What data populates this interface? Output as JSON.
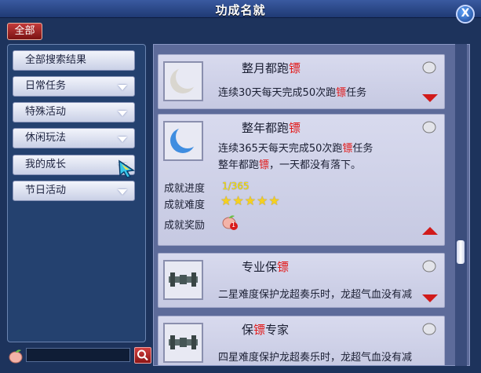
{
  "window": {
    "title": "功成名就",
    "close_label": "X"
  },
  "all_button": "全部",
  "categories": [
    {
      "label": "全部搜索结果",
      "has_chevron": false
    },
    {
      "label": "日常任务",
      "has_chevron": true
    },
    {
      "label": "特殊活动",
      "has_chevron": true
    },
    {
      "label": "休闲玩法",
      "has_chevron": true
    },
    {
      "label": "我的成长",
      "has_chevron": true
    },
    {
      "label": "节日活动",
      "has_chevron": true
    }
  ],
  "search": {
    "value": "",
    "placeholder": ""
  },
  "achievements": [
    {
      "title_pre": "整月都跑",
      "title_red": "镖",
      "title_post": "",
      "desc_pre": "连续30天每天完成50次跑",
      "desc_red": "镖",
      "desc_post": "任务",
      "icon": "crescent-moon-icon",
      "expanded": false
    },
    {
      "title_pre": "整年都跑",
      "title_red": "镖",
      "title_post": "",
      "desc_pre": "连续365天每天完成50次跑",
      "desc_red": "镖",
      "desc_post": "任务",
      "desc2_pre": "整年都跑",
      "desc2_red": "镖",
      "desc2_post": "，一天都没有落下。",
      "icon": "blue-crescent-moon-icon",
      "expanded": true,
      "progress_label": "成就进度",
      "progress_value": "1/365",
      "difficulty_label": "成就难度",
      "difficulty_stars": "★★★★★",
      "reward_label": "成就奖励",
      "reward_count": "1"
    },
    {
      "title_pre": "专业保",
      "title_red": "镖",
      "title_post": "",
      "desc_pre": "二星难度保护龙超奏乐时，龙超气血没有减",
      "desc_red": "",
      "desc_post": "",
      "icon": "chain-ornament-icon",
      "expanded": false
    },
    {
      "title_pre": "保",
      "title_red": "镖",
      "title_post": "专家",
      "desc_pre": "四星难度保护龙超奏乐时，龙超气血没有减",
      "desc_red": "",
      "desc_post": "",
      "icon": "chain-ornament-icon",
      "expanded": false
    }
  ],
  "colors": {
    "accent_red": "#e21b1b",
    "star_yellow": "#f5d020",
    "progress_yellow": "#ffe600"
  }
}
